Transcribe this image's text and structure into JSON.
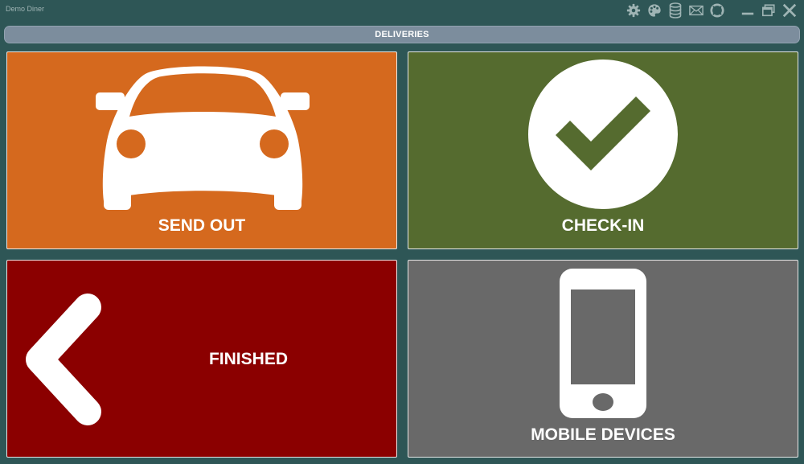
{
  "app": {
    "title": "Demo Diner"
  },
  "header": {
    "title": "DELIVERIES"
  },
  "toolbar_icons": [
    "gear-icon",
    "palette-icon",
    "database-icon",
    "mail-icon",
    "lifebuoy-icon"
  ],
  "window_controls": [
    "minimize-icon",
    "restore-icon",
    "close-icon"
  ],
  "tiles": {
    "send_out": {
      "label": "SEND OUT",
      "color": "#d5691e",
      "icon": "car-icon"
    },
    "check_in": {
      "label": "CHECK-IN",
      "color": "#556b2f",
      "icon": "checkmark-circle-icon"
    },
    "finished": {
      "label": "FINISHED",
      "color": "#8b0000",
      "icon": "chevron-left-icon"
    },
    "mobile_devices": {
      "label": "MOBILE DEVICES",
      "color": "#696969",
      "icon": "smartphone-icon"
    }
  },
  "colors": {
    "background": "#2e5656",
    "header_bar": "#7c8d9d"
  }
}
